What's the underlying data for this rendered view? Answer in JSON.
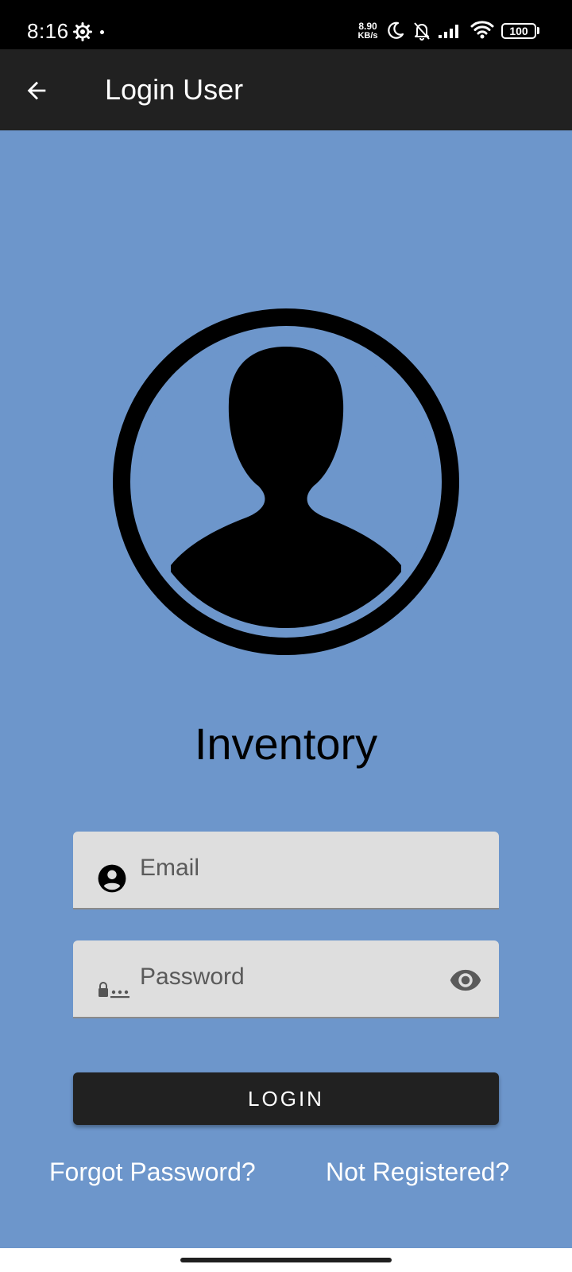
{
  "status_bar": {
    "time": "8:16",
    "net_speed_value": "8.90",
    "net_speed_unit": "KB/s",
    "battery": "100",
    "icons": [
      "gear-icon",
      "dnd-moon-icon",
      "bell-off-icon",
      "signal-icon",
      "wifi-icon",
      "battery-icon"
    ]
  },
  "app_bar": {
    "title": "Login User",
    "back_icon": "arrow-back-icon"
  },
  "main": {
    "app_name": "Inventory",
    "email": {
      "placeholder": "Email",
      "value": "",
      "icon": "account-circle-icon"
    },
    "password": {
      "placeholder": "Password",
      "value": "",
      "icon": "password-icon",
      "toggle_icon": "eye-icon"
    },
    "login_label": "LOGIN",
    "forgot_label": "Forgot Password?",
    "register_label": "Not Registered?"
  },
  "colors": {
    "background": "#6d96cb",
    "app_bar": "#212121",
    "field": "#dedede",
    "button": "#212121"
  }
}
